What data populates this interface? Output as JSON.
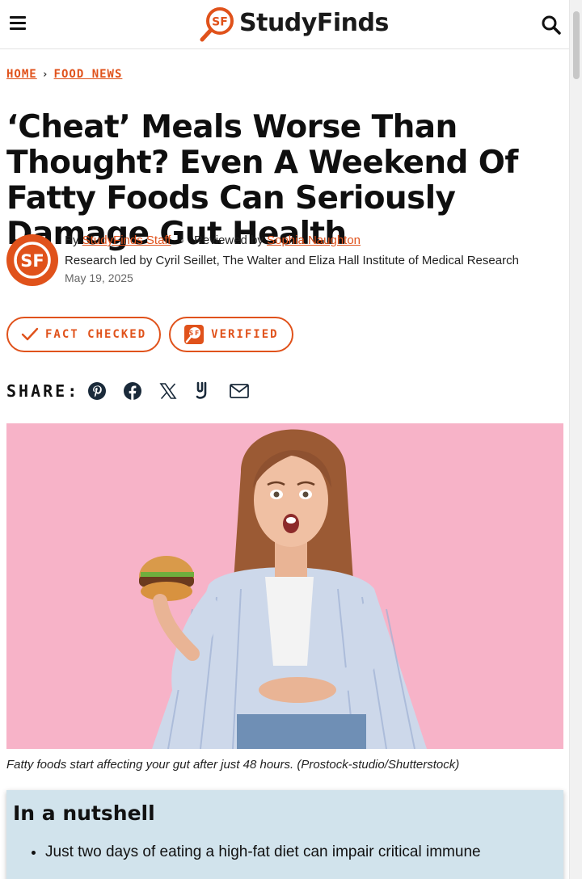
{
  "header": {
    "logo_mark": "SF",
    "logo_text": "StudyFinds"
  },
  "breadcrumb": {
    "items": [
      {
        "label": "HOME"
      },
      {
        "label": "FOOD NEWS"
      }
    ],
    "separator": "›"
  },
  "article": {
    "title": "‘Cheat’ Meals Worse Than Thought? Even A Weekend Of Fatty Foods Can Seriously Damage Gut Health",
    "avatar_text": "SF",
    "byline": {
      "by_prefix": "By",
      "author": "StudyFinds Staff",
      "dot": "•",
      "reviewed_prefix": "Reviewed by",
      "reviewer": "Sophia Naughton",
      "research": "Research led by Cyril Seillet, The Walter and Eliza Hall Institute of Medical Research",
      "date": "May 19, 2025"
    },
    "badges": {
      "fact_checked": "FACT CHECKED",
      "verified": "VERIFIED"
    },
    "share": {
      "label": "SHARE:",
      "icons": [
        "pinterest-icon",
        "facebook-icon",
        "x-icon",
        "yummly-icon",
        "email-icon"
      ]
    },
    "image_caption": "Fatty foods start affecting your gut after just 48 hours. (Prostock-studio/Shutterstock)",
    "nutshell": {
      "heading": "In a nutshell",
      "bullets": [
        "Just two days of eating a high-fat diet can impair critical immune"
      ]
    }
  },
  "colors": {
    "accent": "#e0521b",
    "hero_bg": "#f7b3c8",
    "nutshell_bg": "#d1e3ec"
  }
}
